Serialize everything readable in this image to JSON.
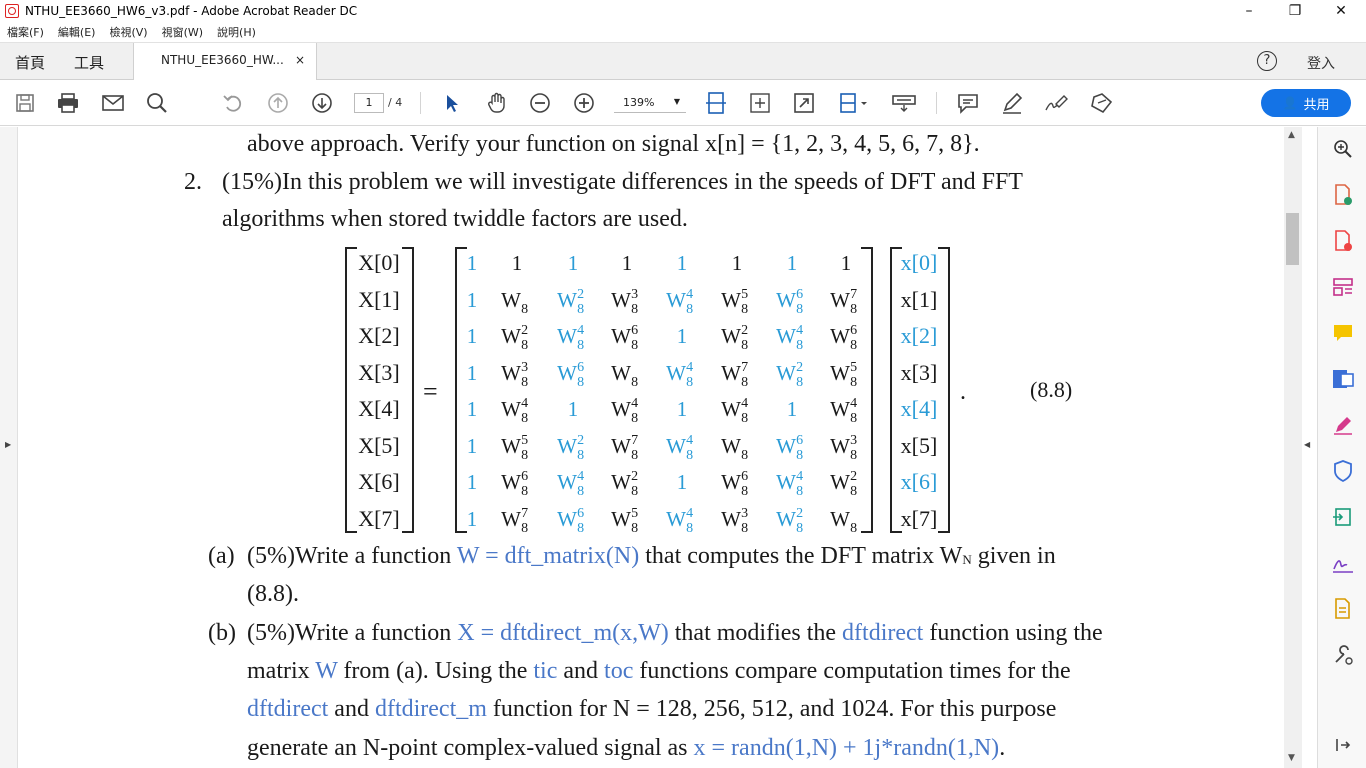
{
  "window": {
    "title": "NTHU_EE3660_HW6_v3.pdf - Adobe Acrobat Reader DC"
  },
  "menu": [
    "檔案(F)",
    "編輯(E)",
    "檢視(V)",
    "視窗(W)",
    "說明(H)"
  ],
  "tabs": {
    "home": "首頁",
    "tools": "工具",
    "doc_tab": "NTHU_EE3660_HW...",
    "close": "×",
    "help": "?",
    "login": "登入"
  },
  "toolbar": {
    "page_current": "1",
    "page_total": "/ 4",
    "zoom": "139%",
    "share_label": "共用"
  },
  "doc": {
    "line0": "above approach. Verify your function on signal x[n] = {1, 2, 3, 4, 5, 6, 7, 8}.",
    "p2_num": "2.",
    "p2_line1": "(15%)In this problem we will investigate differences in the speeds of DFT and FFT",
    "p2_line2": "algorithms when stored twiddle factors are used.",
    "eq_label": "(8.8)",
    "eq_equals": "=",
    "eq_period": ".",
    "a_label": "(a)",
    "a_pct": "(5%)Write a function ",
    "a_code": "W = dft_matrix(N)",
    "a_rest": " that computes the DFT matrix W",
    "a_sub": "N",
    "a_end": " given in",
    "a_line2": "(8.8).",
    "b_label": "(b)",
    "b_pct": "(5%)Write a function ",
    "b_code": "X = dftdirect_m(x,W)",
    "b_mid": " that modifies the ",
    "b_code2": "dftdirect",
    "b_end": " function using the",
    "b2_pre": "matrix ",
    "b2_W": "W",
    "b2_mid": " from (a). Using the ",
    "b2_tic": "tic",
    "b2_and": " and ",
    "b2_toc": "toc",
    "b2_end": " functions compare computation times for the",
    "b3_code1": "dftdirect",
    "b3_and": " and ",
    "b3_code2": "dftdirect_m",
    "b3_end": " function for N = 128, 256, 512, and 1024. For this purpose",
    "b4_pre": "generate an N-point complex-valued signal as ",
    "b4_code": "x = randn(1,N) + 1j*randn(1,N)",
    "b4_end": "."
  },
  "matrix": {
    "lhs": [
      "X[0]",
      "X[1]",
      "X[2]",
      "X[3]",
      "X[4]",
      "X[5]",
      "X[6]",
      "X[7]"
    ],
    "rhs": [
      "x[0]",
      "x[1]",
      "x[2]",
      "x[3]",
      "x[4]",
      "x[5]",
      "x[6]",
      "x[7]"
    ],
    "rows": [
      [
        "1",
        "1",
        "1",
        "1",
        "1",
        "1",
        "1",
        "1"
      ],
      [
        "1",
        "W8",
        "W8^2",
        "W8^3",
        "W8^4",
        "W8^5",
        "W8^6",
        "W8^7"
      ],
      [
        "1",
        "W8^2",
        "W8^4",
        "W8^6",
        "1",
        "W8^2",
        "W8^4",
        "W8^6"
      ],
      [
        "1",
        "W8^3",
        "W8^6",
        "W8",
        "W8^4",
        "W8^7",
        "W8^2",
        "W8^5"
      ],
      [
        "1",
        "W8^4",
        "1",
        "W8^4",
        "1",
        "W8^4",
        "1",
        "W8^4"
      ],
      [
        "1",
        "W8^5",
        "W8^2",
        "W8^7",
        "W8^4",
        "W8",
        "W8^6",
        "W8^3"
      ],
      [
        "1",
        "W8^6",
        "W8^4",
        "W8^2",
        "1",
        "W8^6",
        "W8^4",
        "W8^2"
      ],
      [
        "1",
        "W8^7",
        "W8^6",
        "W8^5",
        "W8^4",
        "W8^3",
        "W8^2",
        "W8"
      ]
    ]
  }
}
